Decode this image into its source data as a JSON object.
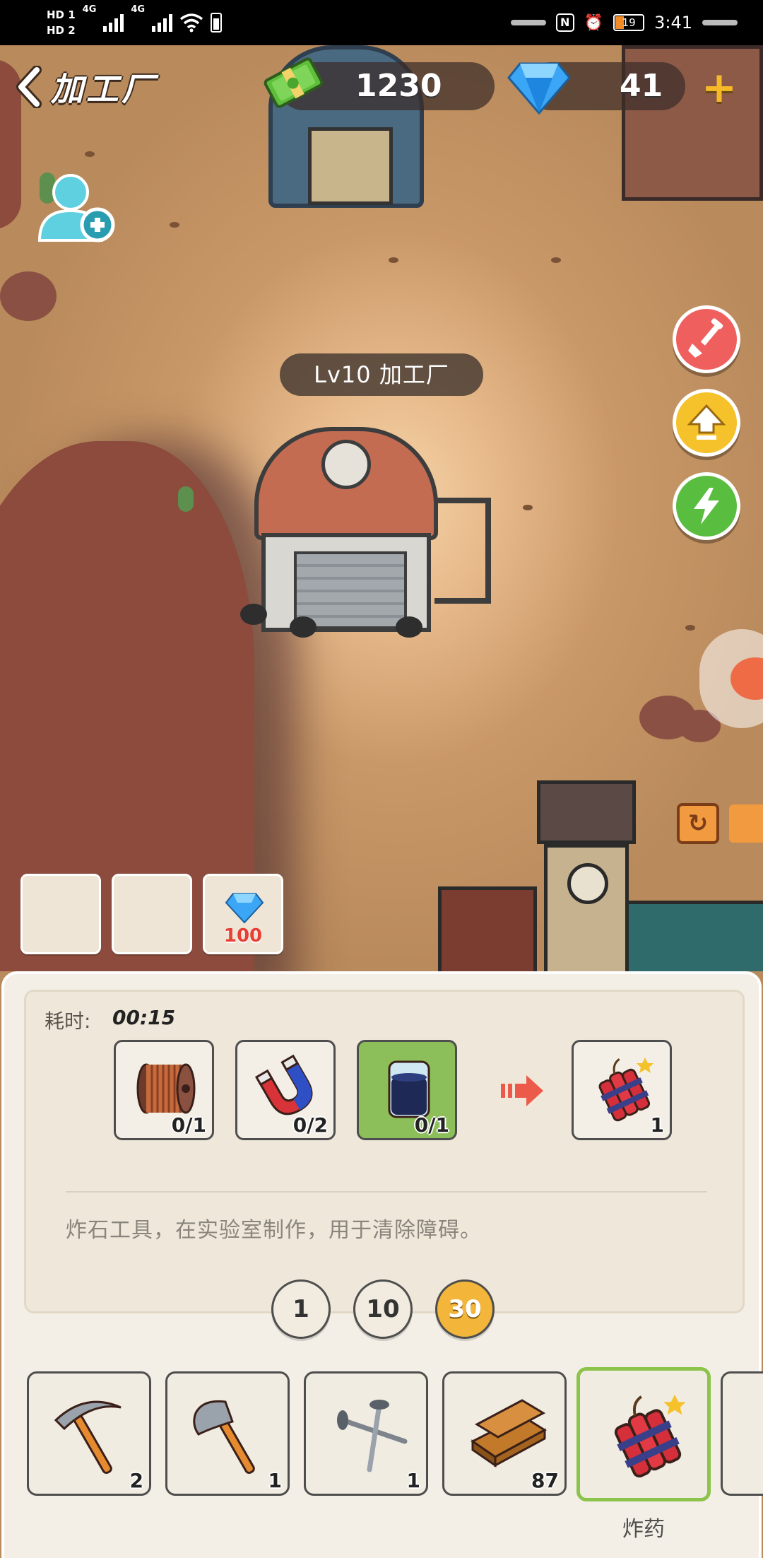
{
  "status_bar": {
    "hd1": "HD 1",
    "hd2": "HD 2",
    "net1": "4G",
    "net2": "4G",
    "battery": "19",
    "time": "3:41",
    "nfc": "N",
    "alarm": "⏰"
  },
  "header": {
    "title": "加工厂",
    "cash": "1230",
    "gems": "41",
    "plus": "+"
  },
  "building_label": "Lv10 加工厂",
  "slots": [
    {
      "cost": ""
    },
    {
      "cost": ""
    },
    {
      "cost": "100"
    }
  ],
  "panel": {
    "time_label": "耗时:",
    "time_value": "00:15",
    "ingredients": [
      {
        "icon": "copper-coil-icon",
        "count": "0/1"
      },
      {
        "icon": "magnet-icon",
        "count": "0/2"
      },
      {
        "icon": "beaker-icon",
        "count": "0/1"
      }
    ],
    "product": {
      "icon": "dynamite-icon",
      "count": "1"
    },
    "description": "炸石工具，在实验室制作，用于清除障碍。",
    "quantities": [
      "1",
      "10",
      "30"
    ],
    "selected_quantity": "30"
  },
  "tools": [
    {
      "icon": "pickaxe-icon",
      "count": "2"
    },
    {
      "icon": "axe-icon",
      "count": "1"
    },
    {
      "icon": "nails-icon",
      "count": "1"
    },
    {
      "icon": "planks-icon",
      "count": "87"
    },
    {
      "icon": "dynamite-icon",
      "count": ""
    }
  ],
  "selected_tool_name": "炸药",
  "colors": {
    "accent_orange": "#f3b63a",
    "selected_green": "#8cc34a",
    "cost_red": "#e83f35"
  }
}
